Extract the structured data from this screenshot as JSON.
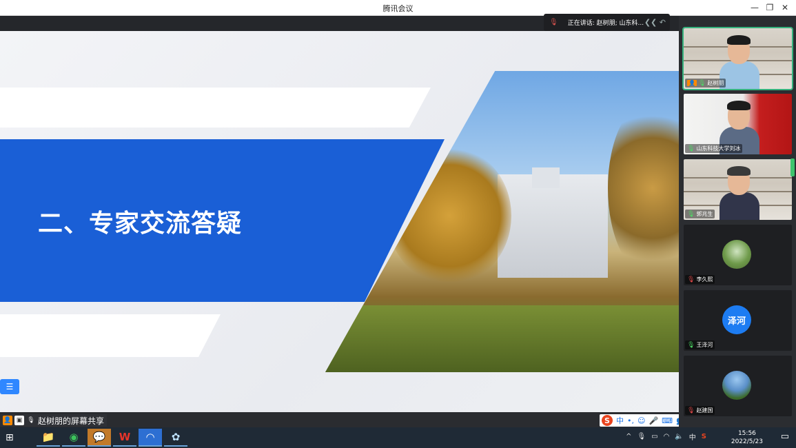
{
  "window": {
    "title": "腾讯会议"
  },
  "speaking": {
    "text": "正在讲话: 赵树朋; 山东科..."
  },
  "slide": {
    "title": "二、专家交流答疑"
  },
  "share": {
    "label": "赵树朋的屏幕共享"
  },
  "participants": [
    {
      "name": "赵树朋",
      "type": "video",
      "mic": "on",
      "host": true
    },
    {
      "name": "山东科技大学刘冰",
      "type": "video",
      "mic": "on",
      "host": false
    },
    {
      "name": "郭兆生",
      "type": "video",
      "mic": "on",
      "host": false
    },
    {
      "name": "李久熙",
      "type": "avatar",
      "mic": "off",
      "host": false
    },
    {
      "name": "王泽河",
      "type": "text-avatar",
      "avatar_text": "泽河",
      "mic": "on",
      "host": false
    },
    {
      "name": "赵建国",
      "type": "avatar",
      "mic": "off",
      "host": false
    }
  ],
  "ime": {
    "mode": "中"
  },
  "taskbar": {
    "time": "15:56",
    "date": "2022/5/23",
    "lang": "中"
  },
  "colors": {
    "slide_blue": "#1a5fd6",
    "active_border": "#36b37e",
    "text_avatar": "#1d7cf2"
  }
}
